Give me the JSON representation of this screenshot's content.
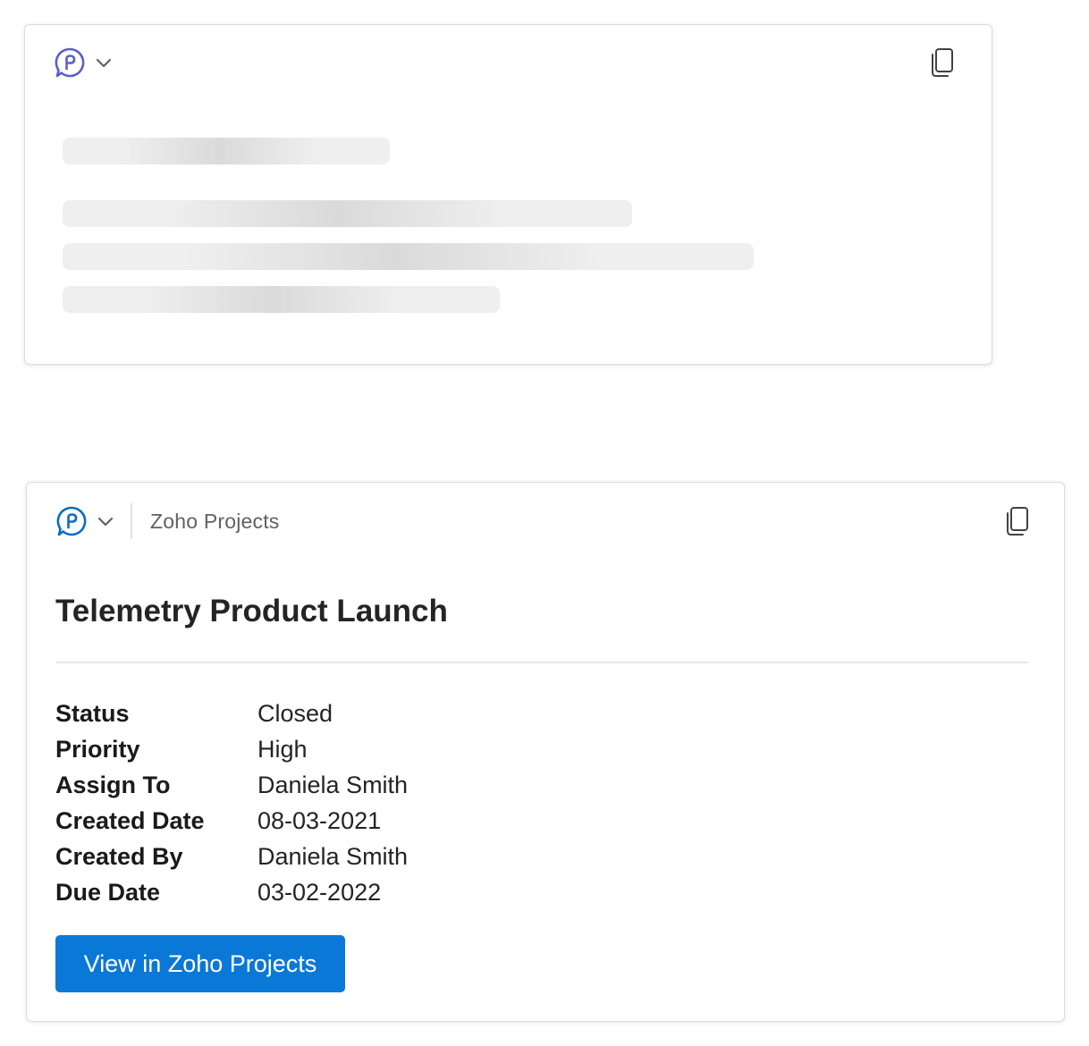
{
  "loading_card": {
    "skeleton_lines": 4
  },
  "result_card": {
    "source": "Zoho Projects",
    "title": "Telemetry Product Launch",
    "facts": [
      {
        "label": "Status",
        "value": "Closed"
      },
      {
        "label": "Priority",
        "value": "High"
      },
      {
        "label": "Assign To",
        "value": "Daniela Smith"
      },
      {
        "label": "Created Date",
        "value": "08-03-2021"
      },
      {
        "label": "Created By",
        "value": "Daniela Smith"
      },
      {
        "label": "Due Date",
        "value": "03-02-2022"
      }
    ],
    "action_button": "View in Zoho Projects"
  },
  "icons": {
    "app_loading": "copilot-chat-icon",
    "app_result": "copilot-chat-icon",
    "dropdown": "chevron-down-icon",
    "copy": "copy-icon"
  },
  "colors": {
    "icon_loading": "#5b5fc7",
    "icon_result": "#0f6cbd",
    "primary_button": "#0a78d7",
    "skeleton_base": "#efefef",
    "skeleton_highlight": "#dadada"
  }
}
